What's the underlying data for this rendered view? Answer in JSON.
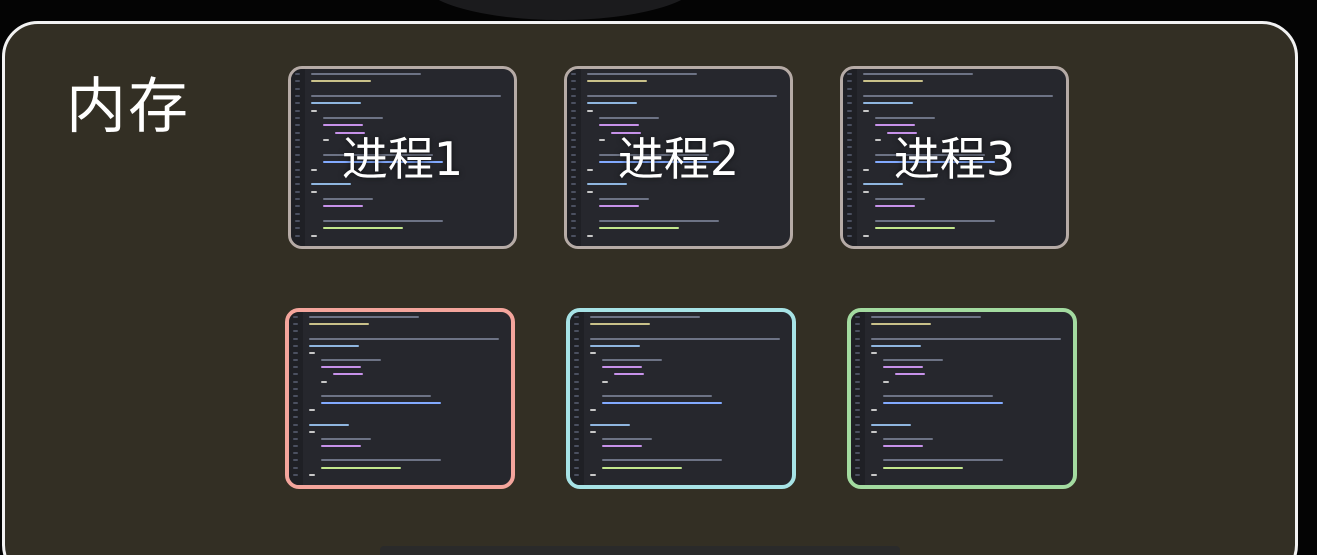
{
  "memory_label": "内存",
  "processes": [
    {
      "label": "进程1"
    },
    {
      "label": "进程2"
    },
    {
      "label": "进程3"
    }
  ],
  "colors": {
    "panel_background": "#332f24",
    "panel_border": "#f2f2f2",
    "top_card_border": "#b6aba6",
    "bottom_card_borders": [
      "#f4a59c",
      "#a7e3e6",
      "#a3dba0"
    ],
    "code_background": "#26272d"
  }
}
